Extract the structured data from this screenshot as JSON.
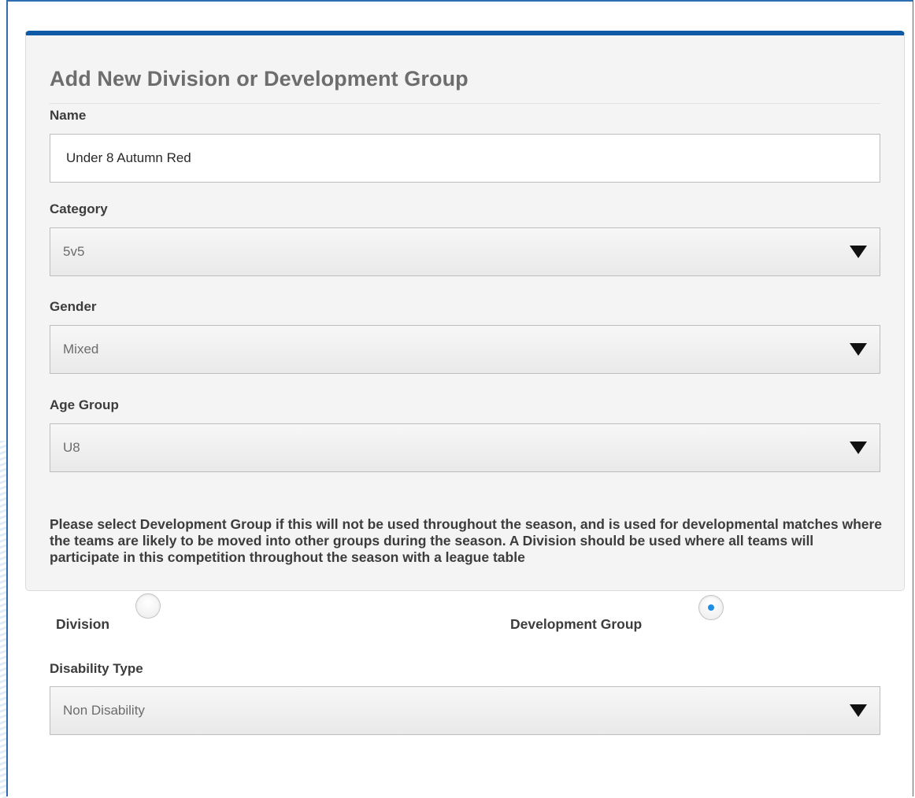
{
  "form": {
    "title": "Add New Division or Development Group",
    "name_label": "Name",
    "name_value": "Under 8 Autumn Red",
    "category_label": "Category",
    "category_value": "5v5",
    "gender_label": "Gender",
    "gender_value": "Mixed",
    "age_group_label": "Age Group",
    "age_group_value": "U8",
    "help_text": "Please select Development Group if this will not be used throughout the season, and is used for developmental matches where the teams are likely to be moved into other groups during the season. A Division should be used where all teams will participate in this competition throughout the season with a league table",
    "type_options": [
      {
        "label": "Division",
        "selected": false
      },
      {
        "label": "Development Group",
        "selected": true
      }
    ],
    "disability_label": "Disability Type",
    "disability_value": "Non Disability"
  },
  "colors": {
    "panel_top_border": "#0e5aa7",
    "page_frame": "#2f6db3",
    "radio_selected": "#1e8fe6"
  },
  "icons": {
    "select_arrow": "caret-down-icon"
  }
}
